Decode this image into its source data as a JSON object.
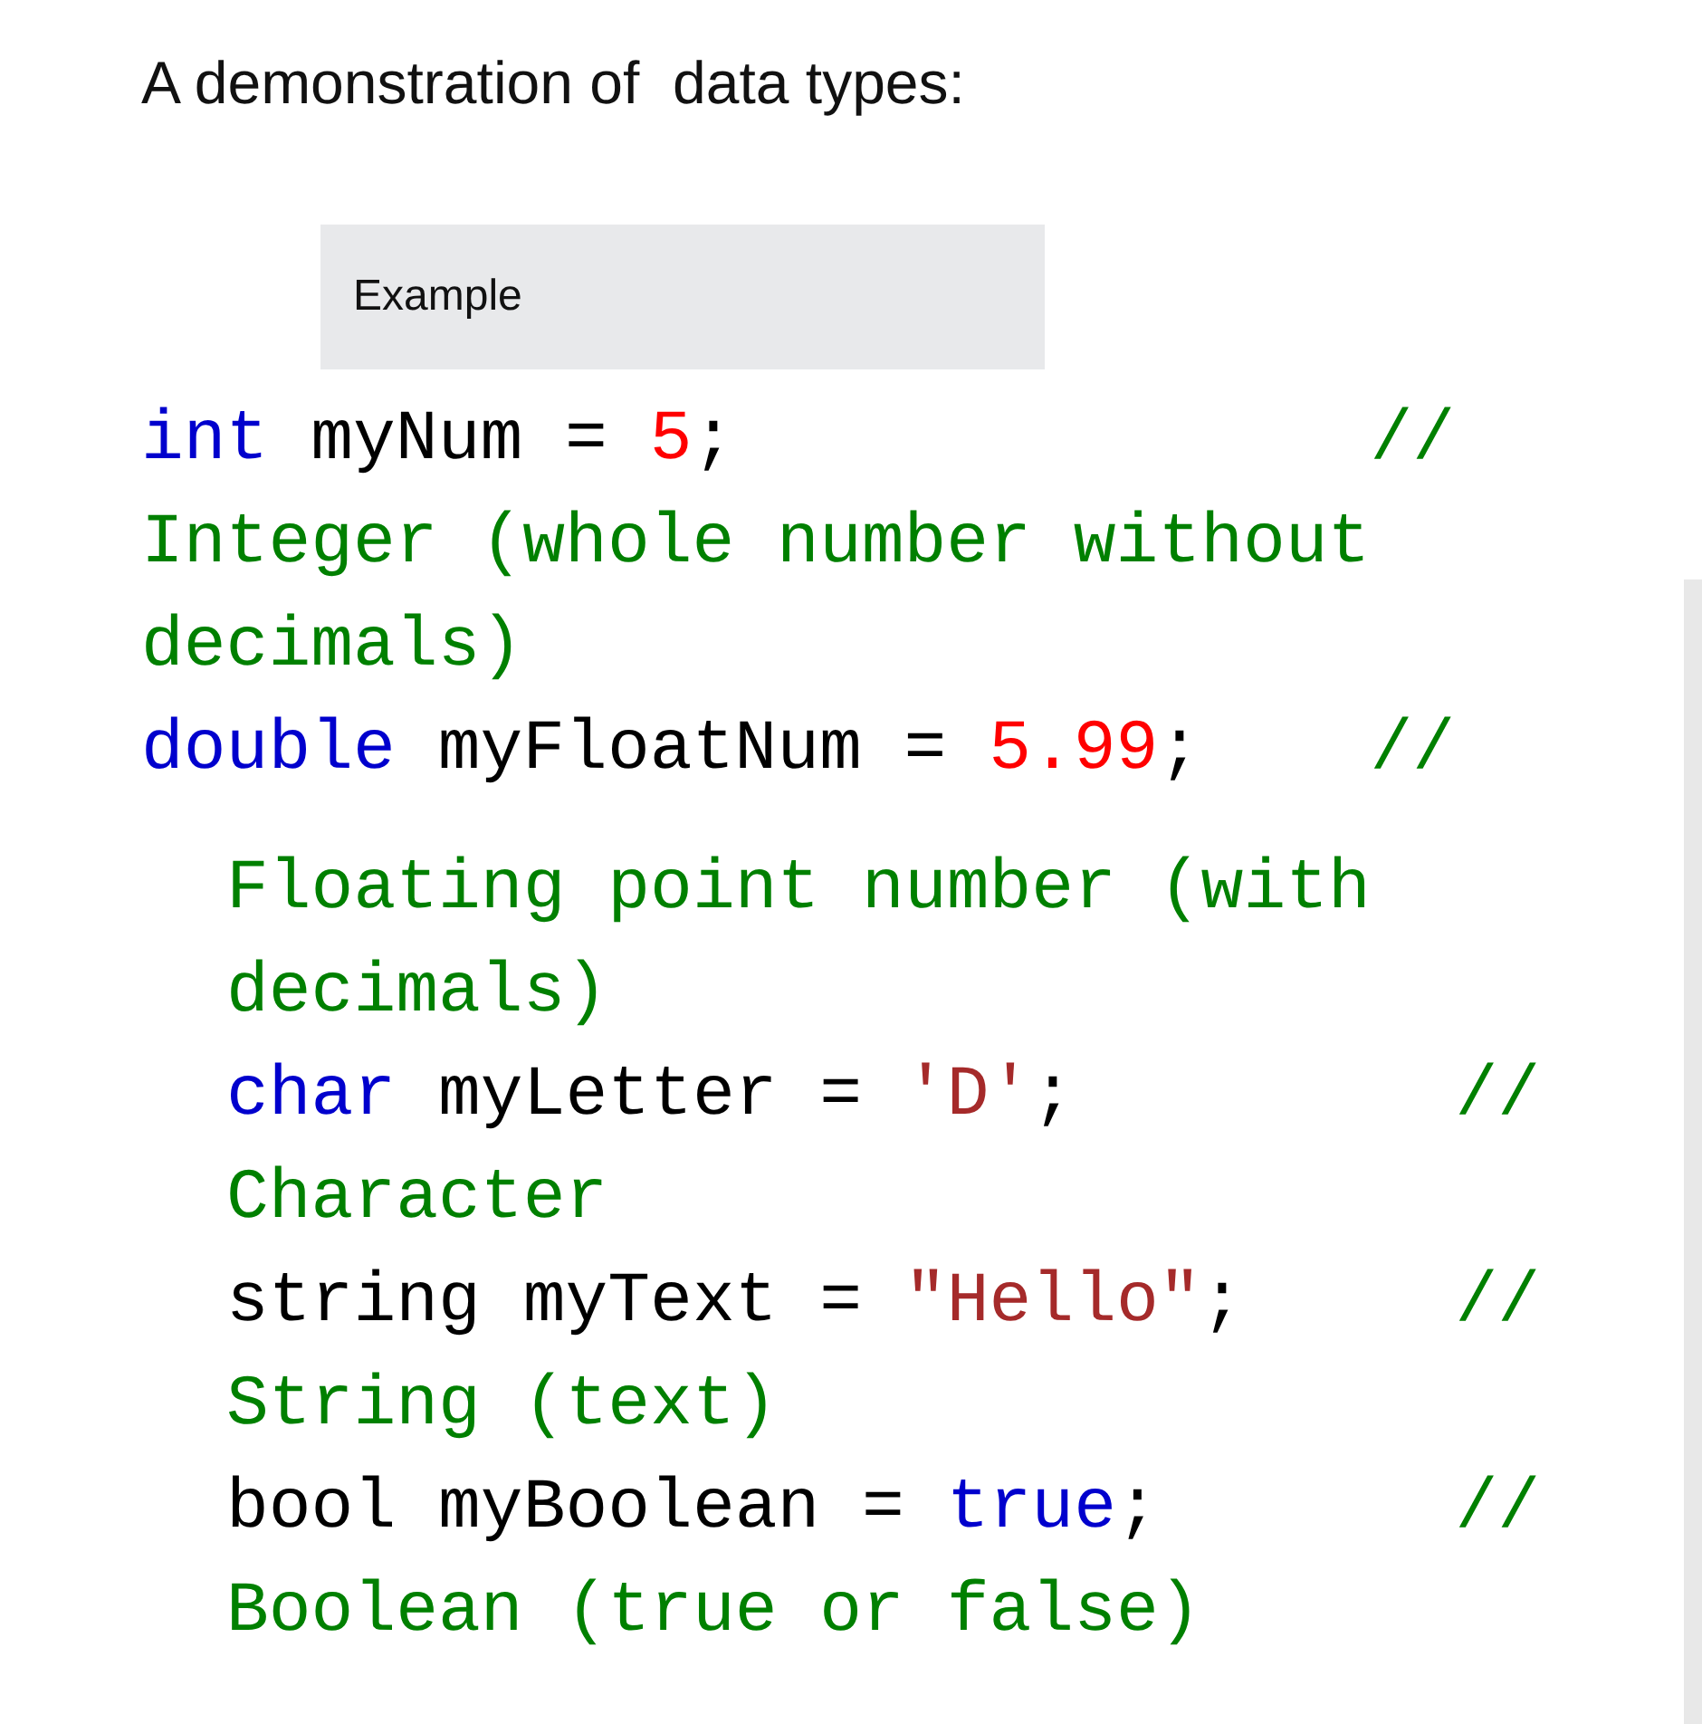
{
  "heading": "A demonstration of  data types:",
  "example_label": "Example",
  "code_blocks": [
    {
      "lines": [
        [
          {
            "kind": "keyword",
            "text": "int"
          },
          {
            "kind": "plain",
            "text": " myNum = "
          },
          {
            "kind": "number",
            "text": "5"
          },
          {
            "kind": "plain",
            "text": ";               "
          },
          {
            "kind": "comment",
            "text": "//"
          }
        ],
        [
          {
            "kind": "comment",
            "text": "Integer (whole number without"
          }
        ],
        [
          {
            "kind": "comment",
            "text": "decimals)"
          }
        ],
        [
          {
            "kind": "keyword",
            "text": "double"
          },
          {
            "kind": "plain",
            "text": " myFloatNum = "
          },
          {
            "kind": "number",
            "text": "5.99"
          },
          {
            "kind": "plain",
            "text": ";    "
          },
          {
            "kind": "comment",
            "text": "//"
          }
        ]
      ]
    },
    {
      "lines": [
        [
          {
            "kind": "comment",
            "text": "Floating point number (with"
          }
        ],
        [
          {
            "kind": "comment",
            "text": "decimals)"
          }
        ],
        [
          {
            "kind": "keyword",
            "text": "char"
          },
          {
            "kind": "plain",
            "text": " myLetter = "
          },
          {
            "kind": "string",
            "text": "'D'"
          },
          {
            "kind": "plain",
            "text": ";         "
          },
          {
            "kind": "comment",
            "text": "//"
          }
        ],
        [
          {
            "kind": "comment",
            "text": "Character"
          }
        ],
        [
          {
            "kind": "plain",
            "text": "string myText = "
          },
          {
            "kind": "string",
            "text": "\"Hello\""
          },
          {
            "kind": "plain",
            "text": ";     "
          },
          {
            "kind": "comment",
            "text": "//"
          }
        ],
        [
          {
            "kind": "comment",
            "text": "String (text)"
          }
        ],
        [
          {
            "kind": "plain",
            "text": "bool myBoolean = "
          },
          {
            "kind": "keyword",
            "text": "true"
          },
          {
            "kind": "plain",
            "text": ";       "
          },
          {
            "kind": "comment",
            "text": "//"
          }
        ],
        [
          {
            "kind": "comment",
            "text": "Boolean (true or false)"
          }
        ]
      ]
    }
  ]
}
